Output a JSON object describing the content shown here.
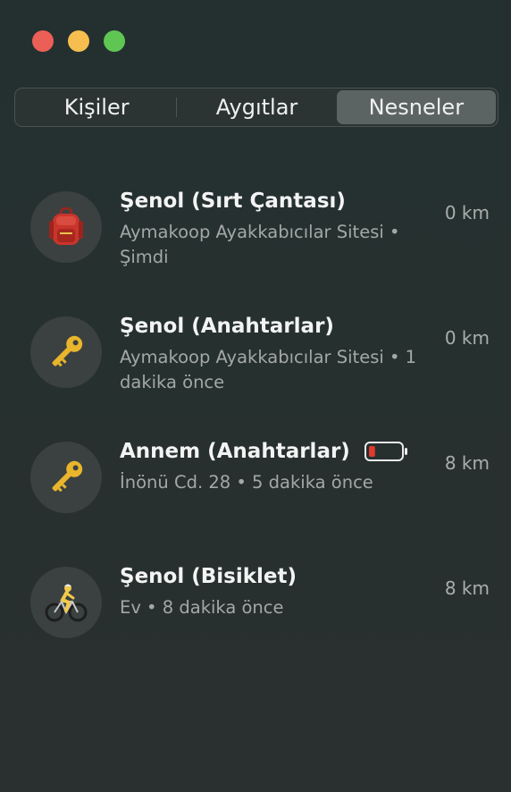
{
  "tabs": [
    {
      "label": "Kişiler",
      "active": false
    },
    {
      "label": "Aygıtlar",
      "active": false
    },
    {
      "label": "Nesneler",
      "active": true
    }
  ],
  "items": [
    {
      "title": "Şenol (Sırt Çantası)",
      "subtitle": "Aymakoop Ayakkabıcılar Sitesi • Şimdi",
      "distance": "0 km",
      "icon": "backpack-icon"
    },
    {
      "title": "Şenol (Anahtarlar)",
      "subtitle": "Aymakoop Ayakkabıcılar Sitesi • 1 dakika önce",
      "distance": "0 km",
      "icon": "key-icon"
    },
    {
      "title": "Annem (Anahtarlar)",
      "subtitle": "İnönü Cd. 28 • 5 dakika önce",
      "distance": "8 km",
      "icon": "key-icon",
      "battery_level": 0.2,
      "battery_color": "#e0392e"
    },
    {
      "title": "Şenol (Bisiklet)",
      "subtitle": "Ev • 8 dakika önce",
      "distance": "8 km",
      "icon": "bicycle-icon"
    }
  ]
}
